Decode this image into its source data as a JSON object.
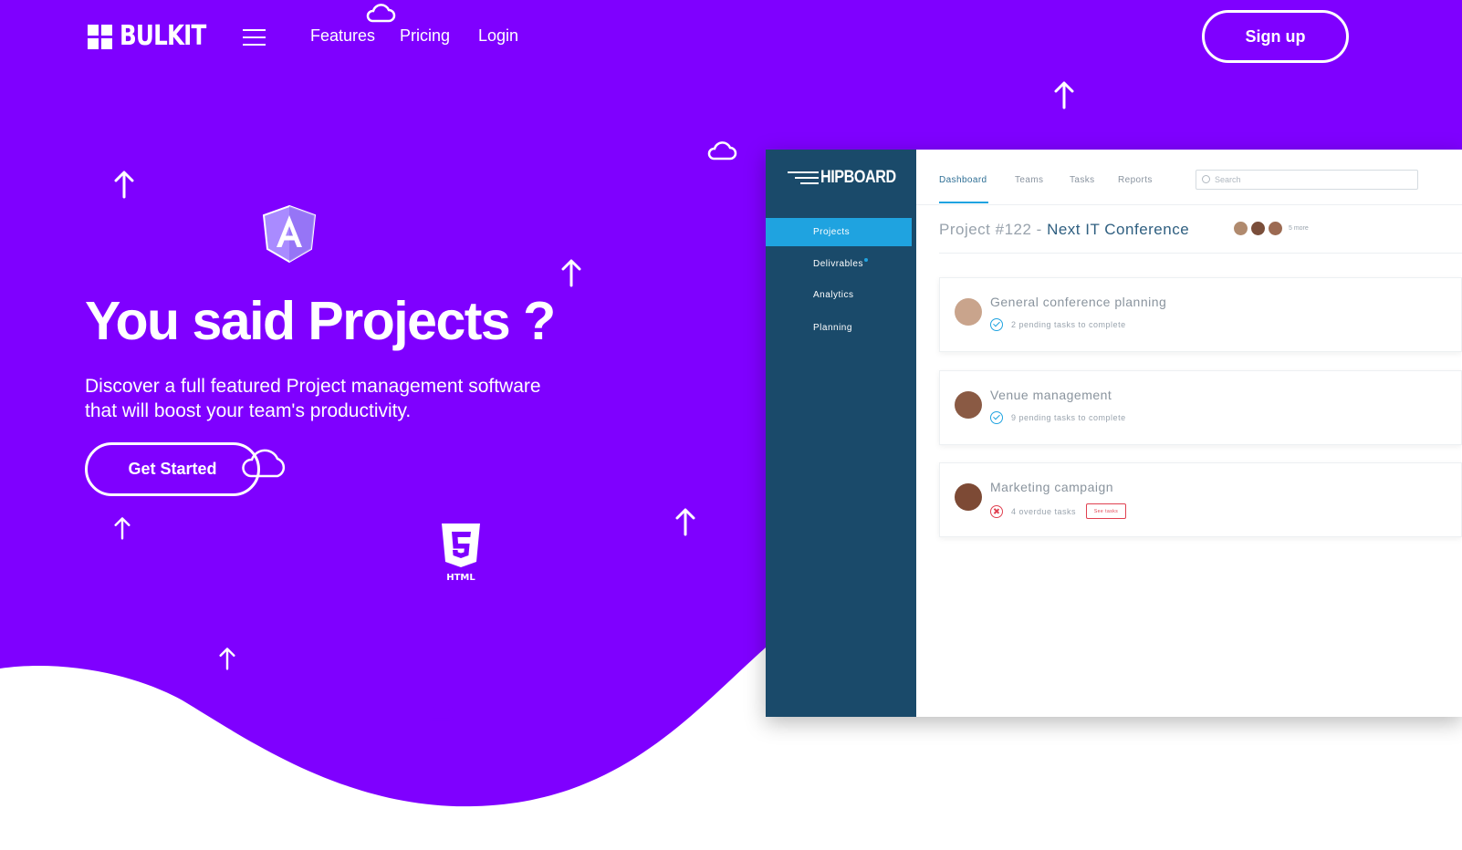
{
  "colors": {
    "primary_purple": "#7f00ff",
    "mockup_sidebar": "#1a4a6a",
    "mockup_accent": "#1fa3e0",
    "danger": "#e04050",
    "background": "#ffffff"
  },
  "nav": {
    "logo_text": "BULKIT",
    "links": [
      "Features",
      "Pricing",
      "Login"
    ],
    "signup_label": "Sign up"
  },
  "hero": {
    "title": "You said Projects ?",
    "subtitle": "Discover a full featured Project management software that will boost your team's productivity.",
    "cta_label": "Get Started"
  },
  "decorations": {
    "icons": [
      "cloud-icon",
      "arrow-up-icon",
      "angular-logo-icon",
      "html5-logo-icon"
    ],
    "html5_label": "HTML"
  },
  "mockup": {
    "logo_text": "HIPBOARD",
    "sidebar_items": [
      "Projects",
      "Delivrables",
      "Analytics",
      "Planning"
    ],
    "active_sidebar": "Projects",
    "tabs": [
      "Dashboard",
      "Teams",
      "Tasks",
      "Reports"
    ],
    "active_tab": "Dashboard",
    "search_placeholder": "Search",
    "project_prefix": "Project #122 -",
    "project_name": "Next IT Conference",
    "avatars_more": "5 more",
    "cards": [
      {
        "title": "General conference planning",
        "status": "2 pending tasks to complete",
        "type": "ok"
      },
      {
        "title": "Venue management",
        "status": "9 pending tasks to complete",
        "type": "ok"
      },
      {
        "title": "Marketing campaign",
        "status": "4 overdue tasks",
        "type": "overdue",
        "action": "See tasks"
      }
    ]
  }
}
